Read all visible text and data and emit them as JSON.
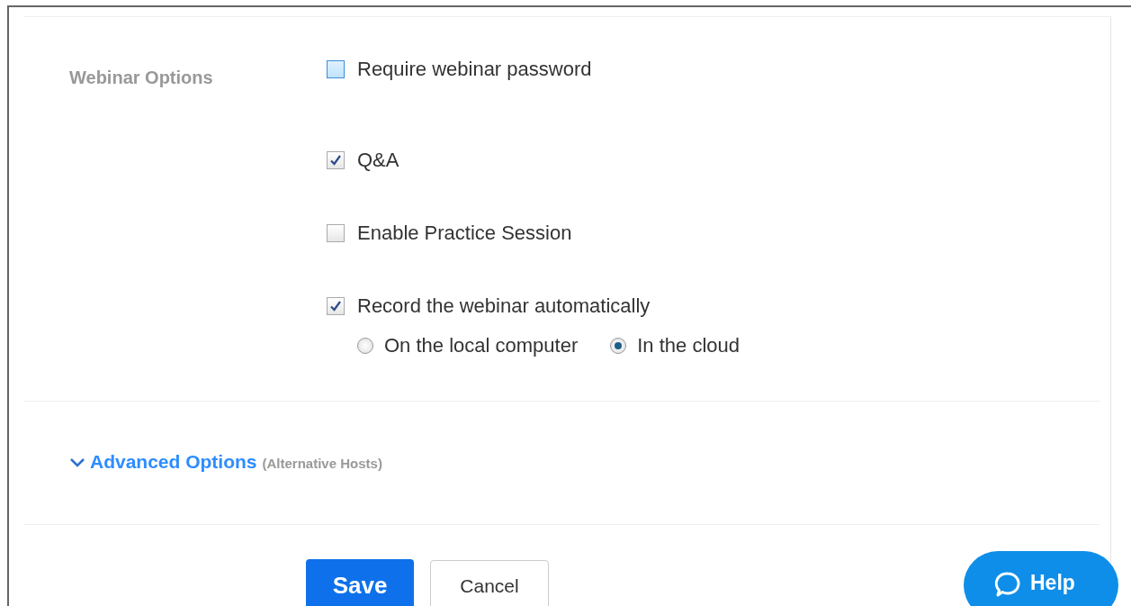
{
  "webinar_options": {
    "label": "Webinar Options",
    "options": [
      {
        "kind": "checkbox",
        "label": "Require webinar password",
        "checked": false,
        "focused": true
      },
      {
        "kind": "checkbox",
        "label": "Q&A",
        "checked": true,
        "focused": false
      },
      {
        "kind": "checkbox",
        "label": "Enable Practice Session",
        "checked": false,
        "focused": false
      },
      {
        "kind": "checkbox",
        "label": "Record the webinar automatically",
        "checked": true,
        "focused": false,
        "choices": [
          {
            "label": "On the local computer",
            "selected": false
          },
          {
            "label": "In the cloud",
            "selected": true
          }
        ]
      }
    ]
  },
  "advanced": {
    "label": "Advanced Options",
    "note": "(Alternative Hosts)"
  },
  "buttons": [
    {
      "kind": "primary",
      "label": "Save"
    },
    {
      "kind": "secondary",
      "label": "Cancel"
    }
  ],
  "help": {
    "label": "Help"
  }
}
